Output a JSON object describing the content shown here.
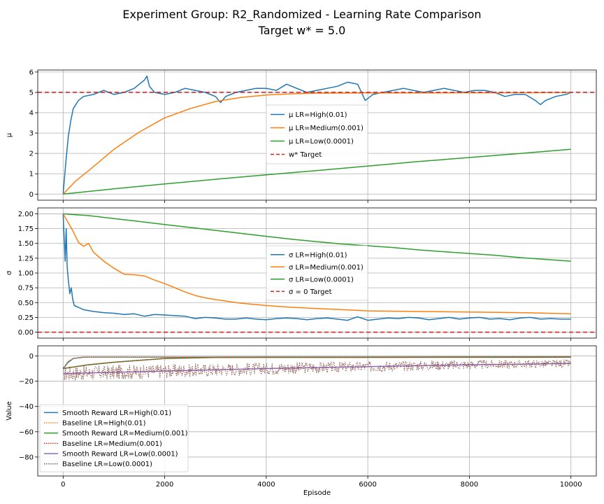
{
  "figure": {
    "title_line1": "Experiment Group: R2_Randomized - Learning Rate Comparison",
    "title_line2": "Target w* = 5.0"
  },
  "colors": {
    "blue": "#1f77b4",
    "orange": "#ff7f0e",
    "green": "#2ca02c",
    "red": "#d62728",
    "purple": "#9467bd",
    "brown": "#8c564b",
    "grid": "#b0b0b0"
  },
  "chart_data": [
    {
      "type": "line",
      "ylabel": "μ",
      "ylim": [
        -0.3,
        6.1
      ],
      "xlim": [
        -500,
        10500
      ],
      "xticks": [
        0,
        2000,
        4000,
        6000,
        8000,
        10000
      ],
      "yticks": [
        0,
        1,
        2,
        3,
        4,
        5,
        6
      ],
      "ytick_labels": [
        "0",
        "1",
        "2",
        "3",
        "4",
        "5",
        "6"
      ],
      "grid": true,
      "legend_position": "center",
      "series": [
        {
          "name": "μ LR=High(0.01)",
          "color": "#1f77b4",
          "points": [
            [
              0,
              0
            ],
            [
              50,
              1.5
            ],
            [
              100,
              2.8
            ],
            [
              150,
              3.6
            ],
            [
              200,
              4.2
            ],
            [
              300,
              4.6
            ],
            [
              400,
              4.8
            ],
            [
              600,
              4.9
            ],
            [
              800,
              5.1
            ],
            [
              1000,
              4.9
            ],
            [
              1200,
              5.0
            ],
            [
              1400,
              5.2
            ],
            [
              1600,
              5.6
            ],
            [
              1650,
              5.8
            ],
            [
              1700,
              5.3
            ],
            [
              1800,
              5.0
            ],
            [
              2000,
              4.9
            ],
            [
              2200,
              5.0
            ],
            [
              2400,
              5.2
            ],
            [
              2600,
              5.1
            ],
            [
              2800,
              5.0
            ],
            [
              3000,
              4.8
            ],
            [
              3100,
              4.5
            ],
            [
              3200,
              4.8
            ],
            [
              3400,
              5.0
            ],
            [
              3600,
              5.1
            ],
            [
              3800,
              5.2
            ],
            [
              4000,
              5.2
            ],
            [
              4200,
              5.1
            ],
            [
              4400,
              5.4
            ],
            [
              4600,
              5.2
            ],
            [
              4800,
              5.0
            ],
            [
              5000,
              5.1
            ],
            [
              5200,
              5.2
            ],
            [
              5400,
              5.3
            ],
            [
              5600,
              5.5
            ],
            [
              5800,
              5.4
            ],
            [
              5950,
              4.6
            ],
            [
              6100,
              4.9
            ],
            [
              6300,
              5.0
            ],
            [
              6500,
              5.1
            ],
            [
              6700,
              5.2
            ],
            [
              6900,
              5.1
            ],
            [
              7100,
              5.0
            ],
            [
              7300,
              5.1
            ],
            [
              7500,
              5.2
            ],
            [
              7700,
              5.1
            ],
            [
              7900,
              5.0
            ],
            [
              8100,
              5.1
            ],
            [
              8300,
              5.1
            ],
            [
              8500,
              5.0
            ],
            [
              8700,
              4.8
            ],
            [
              8900,
              4.9
            ],
            [
              9100,
              4.9
            ],
            [
              9300,
              4.6
            ],
            [
              9400,
              4.4
            ],
            [
              9500,
              4.6
            ],
            [
              9700,
              4.8
            ],
            [
              9900,
              4.9
            ],
            [
              10000,
              5.0
            ]
          ]
        },
        {
          "name": "μ LR=Medium(0.001)",
          "color": "#ff7f0e",
          "points": [
            [
              0,
              0
            ],
            [
              250,
              0.65
            ],
            [
              500,
              1.15
            ],
            [
              1000,
              2.2
            ],
            [
              1500,
              3.05
            ],
            [
              2000,
              3.75
            ],
            [
              2500,
              4.2
            ],
            [
              3000,
              4.55
            ],
            [
              3500,
              4.75
            ],
            [
              4000,
              4.87
            ],
            [
              4500,
              4.93
            ],
            [
              5000,
              4.96
            ],
            [
              6000,
              4.97
            ],
            [
              7000,
              4.97
            ],
            [
              8000,
              4.98
            ],
            [
              9000,
              4.98
            ],
            [
              10000,
              5.0
            ]
          ]
        },
        {
          "name": "μ LR=Low(0.0001)",
          "color": "#2ca02c",
          "points": [
            [
              0,
              0
            ],
            [
              1000,
              0.26
            ],
            [
              2000,
              0.5
            ],
            [
              3000,
              0.73
            ],
            [
              4000,
              0.95
            ],
            [
              5000,
              1.16
            ],
            [
              6000,
              1.38
            ],
            [
              7000,
              1.6
            ],
            [
              8000,
              1.8
            ],
            [
              9000,
              2.0
            ],
            [
              10000,
              2.2
            ]
          ]
        },
        {
          "name": "w* Target",
          "color": "#d62728",
          "dashed": true,
          "hline": 5.0
        }
      ]
    },
    {
      "type": "line",
      "ylabel": "σ",
      "ylim": [
        -0.1,
        2.1
      ],
      "xlim": [
        -500,
        10500
      ],
      "xticks": [
        0,
        2000,
        4000,
        6000,
        8000,
        10000
      ],
      "yticks": [
        0,
        0.25,
        0.5,
        0.75,
        1.0,
        1.25,
        1.5,
        1.75,
        2.0
      ],
      "ytick_labels": [
        "0.00",
        "0.25",
        "0.50",
        "0.75",
        "1.00",
        "1.25",
        "1.50",
        "1.75",
        "2.00"
      ],
      "grid": true,
      "legend_position": "center",
      "series": [
        {
          "name": "σ LR=High(0.01)",
          "color": "#1f77b4",
          "points": [
            [
              0,
              2.0
            ],
            [
              20,
              1.6
            ],
            [
              40,
              1.2
            ],
            [
              60,
              1.75
            ],
            [
              80,
              1.1
            ],
            [
              100,
              0.9
            ],
            [
              130,
              0.65
            ],
            [
              160,
              0.75
            ],
            [
              190,
              0.55
            ],
            [
              220,
              0.45
            ],
            [
              300,
              0.42
            ],
            [
              400,
              0.38
            ],
            [
              600,
              0.35
            ],
            [
              800,
              0.33
            ],
            [
              1000,
              0.32
            ],
            [
              1200,
              0.3
            ],
            [
              1400,
              0.31
            ],
            [
              1600,
              0.27
            ],
            [
              1800,
              0.3
            ],
            [
              2000,
              0.29
            ],
            [
              2200,
              0.28
            ],
            [
              2400,
              0.27
            ],
            [
              2600,
              0.23
            ],
            [
              2800,
              0.25
            ],
            [
              3000,
              0.24
            ],
            [
              3200,
              0.22
            ],
            [
              3400,
              0.22
            ],
            [
              3600,
              0.24
            ],
            [
              3800,
              0.22
            ],
            [
              4000,
              0.21
            ],
            [
              4200,
              0.23
            ],
            [
              4400,
              0.24
            ],
            [
              4600,
              0.23
            ],
            [
              4800,
              0.21
            ],
            [
              5000,
              0.23
            ],
            [
              5200,
              0.24
            ],
            [
              5400,
              0.22
            ],
            [
              5600,
              0.2
            ],
            [
              5800,
              0.26
            ],
            [
              6000,
              0.2
            ],
            [
              6200,
              0.22
            ],
            [
              6400,
              0.24
            ],
            [
              6600,
              0.23
            ],
            [
              6800,
              0.25
            ],
            [
              7000,
              0.24
            ],
            [
              7200,
              0.21
            ],
            [
              7400,
              0.23
            ],
            [
              7600,
              0.25
            ],
            [
              7800,
              0.22
            ],
            [
              8000,
              0.24
            ],
            [
              8200,
              0.25
            ],
            [
              8400,
              0.22
            ],
            [
              8600,
              0.23
            ],
            [
              8800,
              0.21
            ],
            [
              9000,
              0.24
            ],
            [
              9200,
              0.25
            ],
            [
              9400,
              0.22
            ],
            [
              9600,
              0.23
            ],
            [
              9800,
              0.22
            ],
            [
              10000,
              0.22
            ]
          ]
        },
        {
          "name": "σ LR=Medium(0.001)",
          "color": "#ff7f0e",
          "points": [
            [
              0,
              2.0
            ],
            [
              100,
              1.85
            ],
            [
              200,
              1.7
            ],
            [
              300,
              1.52
            ],
            [
              400,
              1.45
            ],
            [
              500,
              1.5
            ],
            [
              600,
              1.35
            ],
            [
              800,
              1.2
            ],
            [
              1000,
              1.08
            ],
            [
              1200,
              0.98
            ],
            [
              1400,
              0.97
            ],
            [
              1600,
              0.95
            ],
            [
              1800,
              0.88
            ],
            [
              2000,
              0.82
            ],
            [
              2200,
              0.75
            ],
            [
              2400,
              0.68
            ],
            [
              2600,
              0.62
            ],
            [
              2800,
              0.58
            ],
            [
              3000,
              0.55
            ],
            [
              3500,
              0.49
            ],
            [
              4000,
              0.45
            ],
            [
              4500,
              0.42
            ],
            [
              5000,
              0.4
            ],
            [
              5500,
              0.38
            ],
            [
              6000,
              0.36
            ],
            [
              7000,
              0.35
            ],
            [
              8000,
              0.34
            ],
            [
              9000,
              0.33
            ],
            [
              10000,
              0.31
            ]
          ]
        },
        {
          "name": "σ LR=Low(0.0001)",
          "color": "#2ca02c",
          "points": [
            [
              0,
              2.0
            ],
            [
              500,
              1.97
            ],
            [
              1000,
              1.92
            ],
            [
              1500,
              1.87
            ],
            [
              2000,
              1.82
            ],
            [
              2500,
              1.77
            ],
            [
              3000,
              1.72
            ],
            [
              3500,
              1.67
            ],
            [
              4000,
              1.62
            ],
            [
              4500,
              1.57
            ],
            [
              5000,
              1.53
            ],
            [
              5500,
              1.49
            ],
            [
              6000,
              1.46
            ],
            [
              6500,
              1.43
            ],
            [
              7000,
              1.39
            ],
            [
              7500,
              1.36
            ],
            [
              8000,
              1.33
            ],
            [
              8500,
              1.3
            ],
            [
              9000,
              1.26
            ],
            [
              9500,
              1.23
            ],
            [
              10000,
              1.2
            ]
          ]
        },
        {
          "name": "σ = 0 Target",
          "color": "#d62728",
          "dashed": true,
          "hline": 0.0
        }
      ]
    },
    {
      "type": "line",
      "ylabel": "Value",
      "xlabel": "Episode",
      "ylim": [
        -95,
        8
      ],
      "xlim": [
        -500,
        10500
      ],
      "xticks": [
        0,
        2000,
        4000,
        6000,
        8000,
        10000
      ],
      "yticks": [
        0,
        -20,
        -40,
        -60,
        -80
      ],
      "ytick_labels": [
        "0",
        "−20",
        "−40",
        "−60",
        "−80"
      ],
      "grid": true,
      "legend_position": "lower-left",
      "series": [
        {
          "name": "Smooth Reward LR=High(0.01)",
          "color": "#1f77b4",
          "style": "solid",
          "points": [
            [
              0,
              -10
            ],
            [
              100,
              -5
            ],
            [
              200,
              -2
            ],
            [
              400,
              -1
            ],
            [
              10000,
              -0.8
            ]
          ]
        },
        {
          "name": "Baseline LR=High(0.01)",
          "color": "#ff7f0e",
          "style": "dotted",
          "points": [
            [
              0,
              -10
            ],
            [
              100,
              -4
            ],
            [
              200,
              -2
            ],
            [
              400,
              -1
            ],
            [
              10000,
              -0.8
            ]
          ]
        },
        {
          "name": "Smooth Reward LR=Medium(0.001)",
          "color": "#2ca02c",
          "style": "solid",
          "points": [
            [
              0,
              -10
            ],
            [
              500,
              -7
            ],
            [
              1000,
              -5
            ],
            [
              1500,
              -3.5
            ],
            [
              2000,
              -2
            ],
            [
              3000,
              -1.2
            ],
            [
              10000,
              -1
            ]
          ]
        },
        {
          "name": "Baseline LR=Medium(0.001)",
          "color": "#d62728",
          "style": "dotted",
          "points": [
            [
              0,
              -10
            ],
            [
              500,
              -7
            ],
            [
              1000,
              -5
            ],
            [
              1500,
              -3.5
            ],
            [
              2000,
              -2
            ],
            [
              3000,
              -1.2
            ],
            [
              10000,
              -1
            ]
          ]
        },
        {
          "name": "Smooth Reward LR=Low(0.0001)",
          "color": "#9467bd",
          "style": "solid",
          "points": [
            [
              0,
              -14
            ],
            [
              2000,
              -12
            ],
            [
              4000,
              -10
            ],
            [
              6000,
              -8.5
            ],
            [
              8000,
              -7
            ],
            [
              10000,
              -6
            ]
          ]
        },
        {
          "name": "Baseline LR=Low(0.0001)",
          "color": "#8c564b",
          "style": "dotted",
          "noisy": true,
          "points": [
            [
              0,
              -14
            ],
            [
              2000,
              -12
            ],
            [
              4000,
              -10
            ],
            [
              6000,
              -8.5
            ],
            [
              8000,
              -7
            ],
            [
              10000,
              -6
            ]
          ]
        }
      ]
    }
  ]
}
